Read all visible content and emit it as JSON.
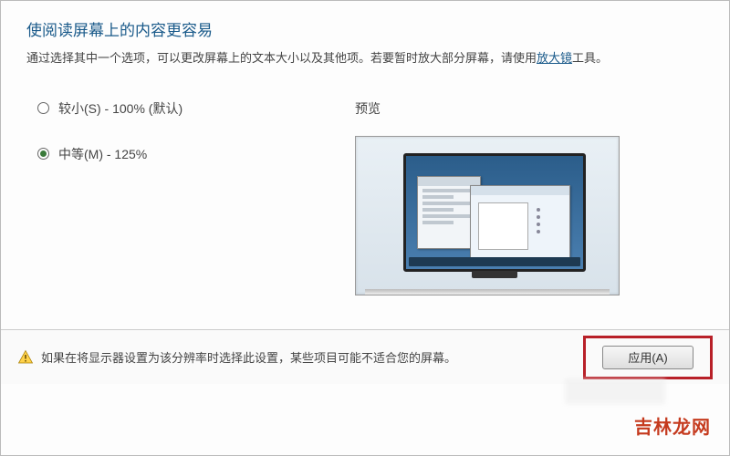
{
  "title": "使阅读屏幕上的内容更容易",
  "description_prefix": "通过选择其中一个选项，可以更改屏幕上的文本大小以及其他项。若要暂时放大部分屏幕，请使用",
  "magnifier_link": "放大镜",
  "description_suffix": "工具。",
  "options": {
    "smaller": {
      "label": "较小(S) - 100% (默认)",
      "selected": false
    },
    "medium": {
      "label": "中等(M) - 125%",
      "selected": true
    }
  },
  "preview_label": "预览",
  "warning_text": "如果在将显示器设置为该分辨率时选择此设置，某些项目可能不适合您的屏幕。",
  "apply_button": "应用(A)",
  "watermark": "吉林龙网"
}
